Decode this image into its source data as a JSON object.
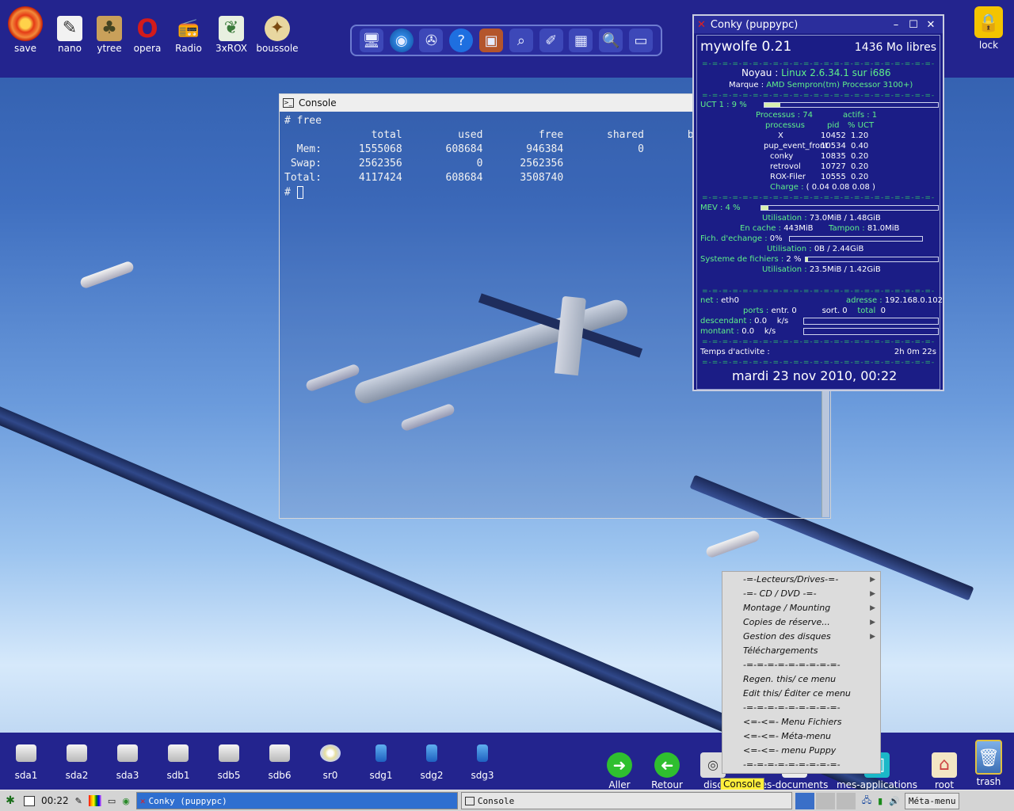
{
  "desktop_top_icons": [
    {
      "label": "save",
      "icon": "save-icon",
      "color": "#e53a16"
    },
    {
      "label": "nano",
      "icon": "nano-notepad-icon"
    },
    {
      "label": "ytree",
      "icon": "ytree-icon"
    },
    {
      "label": "opera",
      "icon": "opera-icon",
      "color": "#d31b1b"
    },
    {
      "label": "Radio",
      "icon": "radio-icon"
    },
    {
      "label": "3xROX",
      "icon": "rox-icon"
    },
    {
      "label": "boussole",
      "icon": "compass-icon"
    }
  ],
  "lock": {
    "label": "lock",
    "icon": "lock-icon"
  },
  "toolbar_icons": [
    "desktop-icon",
    "globe-icon",
    "film-reel-icon",
    "help-icon",
    "briefcase-icon",
    "search-doc-icon",
    "draw-icon",
    "calculator-icon",
    "magnifier-icon",
    "monitor-icon"
  ],
  "conky": {
    "window_title": "Conky (puppypc)",
    "name": "mywolfe 0.21",
    "free_mem": "1436 Mo libres",
    "noyau_label": "Noyau :",
    "noyau_value": "Linux 2.6.34.1 sur i686",
    "marque_label": "Marque :",
    "marque_value": "AMD Sempron(tm) Processor 3100+)",
    "uct_label": "UCT 1 : 9 %",
    "uct_pct": 9,
    "processus_label": "Processus : 74",
    "actifs_label": "actifs : 1",
    "proc_header_name": "processus",
    "proc_header_pid": "pid",
    "proc_header_uct": "% UCT",
    "processes": [
      {
        "name": "X",
        "pid": "10452",
        "uct": "1.20"
      },
      {
        "name": "pup_event_front",
        "pid": "10534",
        "uct": "0.40"
      },
      {
        "name": "conky",
        "pid": "10835",
        "uct": "0.20"
      },
      {
        "name": "retrovol",
        "pid": "10727",
        "uct": "0.20"
      },
      {
        "name": "ROX-Filer",
        "pid": "10555",
        "uct": "0.20"
      }
    ],
    "charge_label": "Charge :",
    "charge_value": "( 0.04 0.08 0.08 )",
    "mev_label": "MEV :  4 %",
    "mev_pct": 4,
    "util_label": "Utilisation :",
    "util_value": "73.0MiB / 1.48GiB",
    "cache_label": "En cache :",
    "cache_value": "443MiB",
    "tampon_label": "Tampon :",
    "tampon_value": "81.0MiB",
    "swap_label": "Fich. d'echange :",
    "swap_value": "0%",
    "swap_pct": 0,
    "swap_util_label": "Utilisation :",
    "swap_util_value": "0B     / 2.44GiB",
    "fs_label": "Systeme de fichiers :",
    "fs_value": "2 %",
    "fs_pct": 2,
    "fs_util_label": "Utilisation :",
    "fs_util_value": "23.5MiB / 1.42GiB",
    "net_label": "net :",
    "net_value": "eth0",
    "adresse_label": "adresse :",
    "adresse_value": "192.168.0.102",
    "ports_label": "ports :",
    "entr_label": "entr. 0",
    "sort_label": "sort. 0",
    "total_label": "total",
    "total_value": "0",
    "desc_label": "descendant :",
    "desc_value": "0.0",
    "desc_unit": "k/s",
    "mont_label": "montant :",
    "mont_value": "0.0",
    "mont_unit": "k/s",
    "temps_label": "Temps d'activite :",
    "temps_value": "2h 0m 22s",
    "date": "mardi 23 nov 2010, 00:22"
  },
  "console": {
    "title": "Console",
    "lines": [
      "# free",
      "              total         used         free       shared       b",
      "  Mem:      1555068       608684       946384            0",
      " Swap:      2562356            0      2562356",
      "Total:      4117424       608684      3508740",
      "# "
    ]
  },
  "menu": {
    "items": [
      {
        "label": "-=-Lecteurs/Drives-=-",
        "submenu": true
      },
      {
        "label": "-=- CD / DVD -=-",
        "submenu": true
      },
      {
        "label": "Montage / Mounting",
        "submenu": true
      },
      {
        "label": "Copies de réserve...",
        "submenu": true
      },
      {
        "label": "Gestion des disques",
        "submenu": true
      },
      {
        "label": "Téléchargements",
        "submenu": false
      },
      {
        "label": "-=-=-=-=-=-=-=-=-=-",
        "submenu": false
      },
      {
        "label": "Regen. this/ ce menu",
        "submenu": false
      },
      {
        "label": "Edit this/ Éditer ce menu",
        "submenu": false
      },
      {
        "label": "-=-=-=-=-=-=-=-=-=-",
        "submenu": false
      },
      {
        "label": "<=-<=- Menu Fichiers",
        "submenu": false
      },
      {
        "label": "<=-<=- Méta-menu",
        "submenu": false
      },
      {
        "label": "<=-<=- menu Puppy",
        "submenu": false
      },
      {
        "label": "-=-=-=-=-=-=-=-=-=-",
        "submenu": false
      }
    ]
  },
  "drives": [
    "sda1",
    "sda2",
    "sda3",
    "sdb1",
    "sdb5",
    "sdb6",
    "sr0",
    "sdg1",
    "sdg2",
    "sdg3"
  ],
  "bottom_right_icons": [
    {
      "label": "Aller",
      "icon": "forward-arrow-icon"
    },
    {
      "label": "Retour",
      "icon": "back-arrow-icon"
    },
    {
      "label": "disc",
      "icon": "disc-icon"
    },
    {
      "label": "es-documents",
      "icon": "documents-icon"
    },
    {
      "label": "mes-applications",
      "icon": "applications-icon"
    },
    {
      "label": "root",
      "icon": "home-icon"
    },
    {
      "label": "trash",
      "icon": "trash-icon"
    }
  ],
  "taskbar": {
    "clock": "00:22",
    "task1": "Conky (puppypc)",
    "task2": "Console",
    "menu_button": "Méta-menu"
  },
  "tooltip": "Console"
}
